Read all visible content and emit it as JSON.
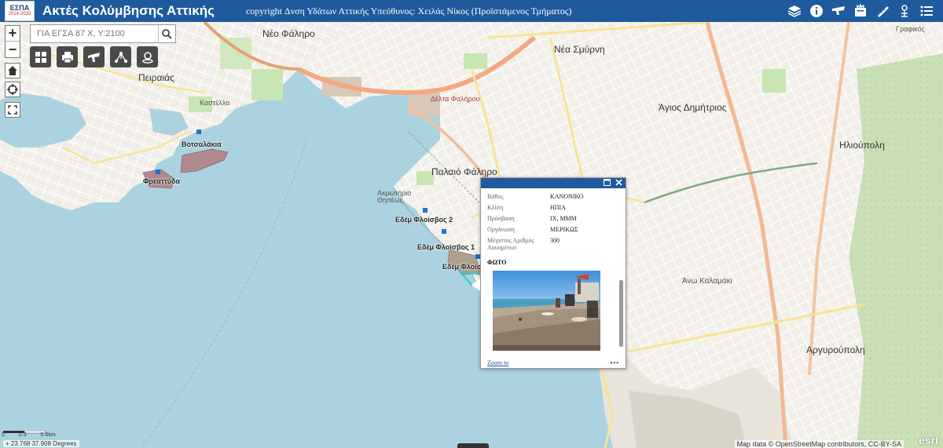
{
  "header": {
    "logo_top": "ΕΣΠΑ",
    "logo_bottom": "2014-2020",
    "title": "Ακτές Κολύμβησης Αττικής",
    "subtitle": "copyright Δνση Υδάτων Αττικής Υπεύθυνος: Χειλάς Νίκος (Προϊστάμενος Τμήματος)",
    "icons": [
      "layers-icon",
      "info-icon",
      "weather-icon",
      "legend-icon",
      "measure-icon",
      "locate-icon",
      "list-icon"
    ]
  },
  "controls": {
    "zoom_in": "+",
    "zoom_out": "−",
    "search_placeholder": "ΓΙΑ ΕΓΣΑ 87 Χ, Υ:2100"
  },
  "map_labels": {
    "neo_faliro": "Νέο Φάληρο",
    "neo_smyrni": "Νέα Σμύρνη",
    "agios_dimitrios": "Άγιος Δημήτριος",
    "peiraias": "Πειραιάς",
    "paleo_faliro": "Παλαιό Φάληρο",
    "ilioupoli": "Ηλιούπολη",
    "ano_kalamaki": "Άνω Καλαμάκι",
    "argyroupoli": "Αργυρούπολη",
    "delta_falirou": "Δέλτα Φαλήρου",
    "akrotirio_thiseos": "Ακρωτήριο Θησέως",
    "kastella": "Καστέλλα",
    "grafikos": "Γραφικός"
  },
  "beaches": {
    "votsalakia": "Βοτσαλάκια",
    "freattyda": "Φρεαττύδα",
    "edem_2": "Εδέμ Φλοίσβος 2",
    "edem_1": "Εδέμ  Φλοίσβος 1",
    "edem_cut": "Εδέμ  Φλοίσ"
  },
  "popup": {
    "rows": [
      {
        "key": "Βάθος",
        "value": "ΚΑΝΟΝΙΚΟ"
      },
      {
        "key": "Κλίση",
        "value": "ΗΠΙΑ"
      },
      {
        "key": "Πρόσβαση",
        "value": "ΙΧ, ΜΜΜ"
      },
      {
        "key": "Οργάνωση",
        "value": "ΜΕΡΙΚΩΣ"
      },
      {
        "key": "Μέγιστος Αριθμός Λουομένων",
        "value": "300"
      }
    ],
    "photo_heading": "ΦΩΤΟ",
    "zoom_to": "Zoom to",
    "more": "•••"
  },
  "footer": {
    "scale_labels": [
      "0",
      "0.3",
      "0.6km"
    ],
    "coordinates": "23.768 37.908 Degrees",
    "attribution": "Map data © OpenStreetMap contributors, CC-BY-SA",
    "esri": "esri"
  },
  "colors": {
    "header_bg": "#1f5a9c",
    "sea": "#aad3df",
    "land": "#f2efe9",
    "beach_polygon": "#b08a8e",
    "toolbar_btn": "#4a4a4a"
  }
}
